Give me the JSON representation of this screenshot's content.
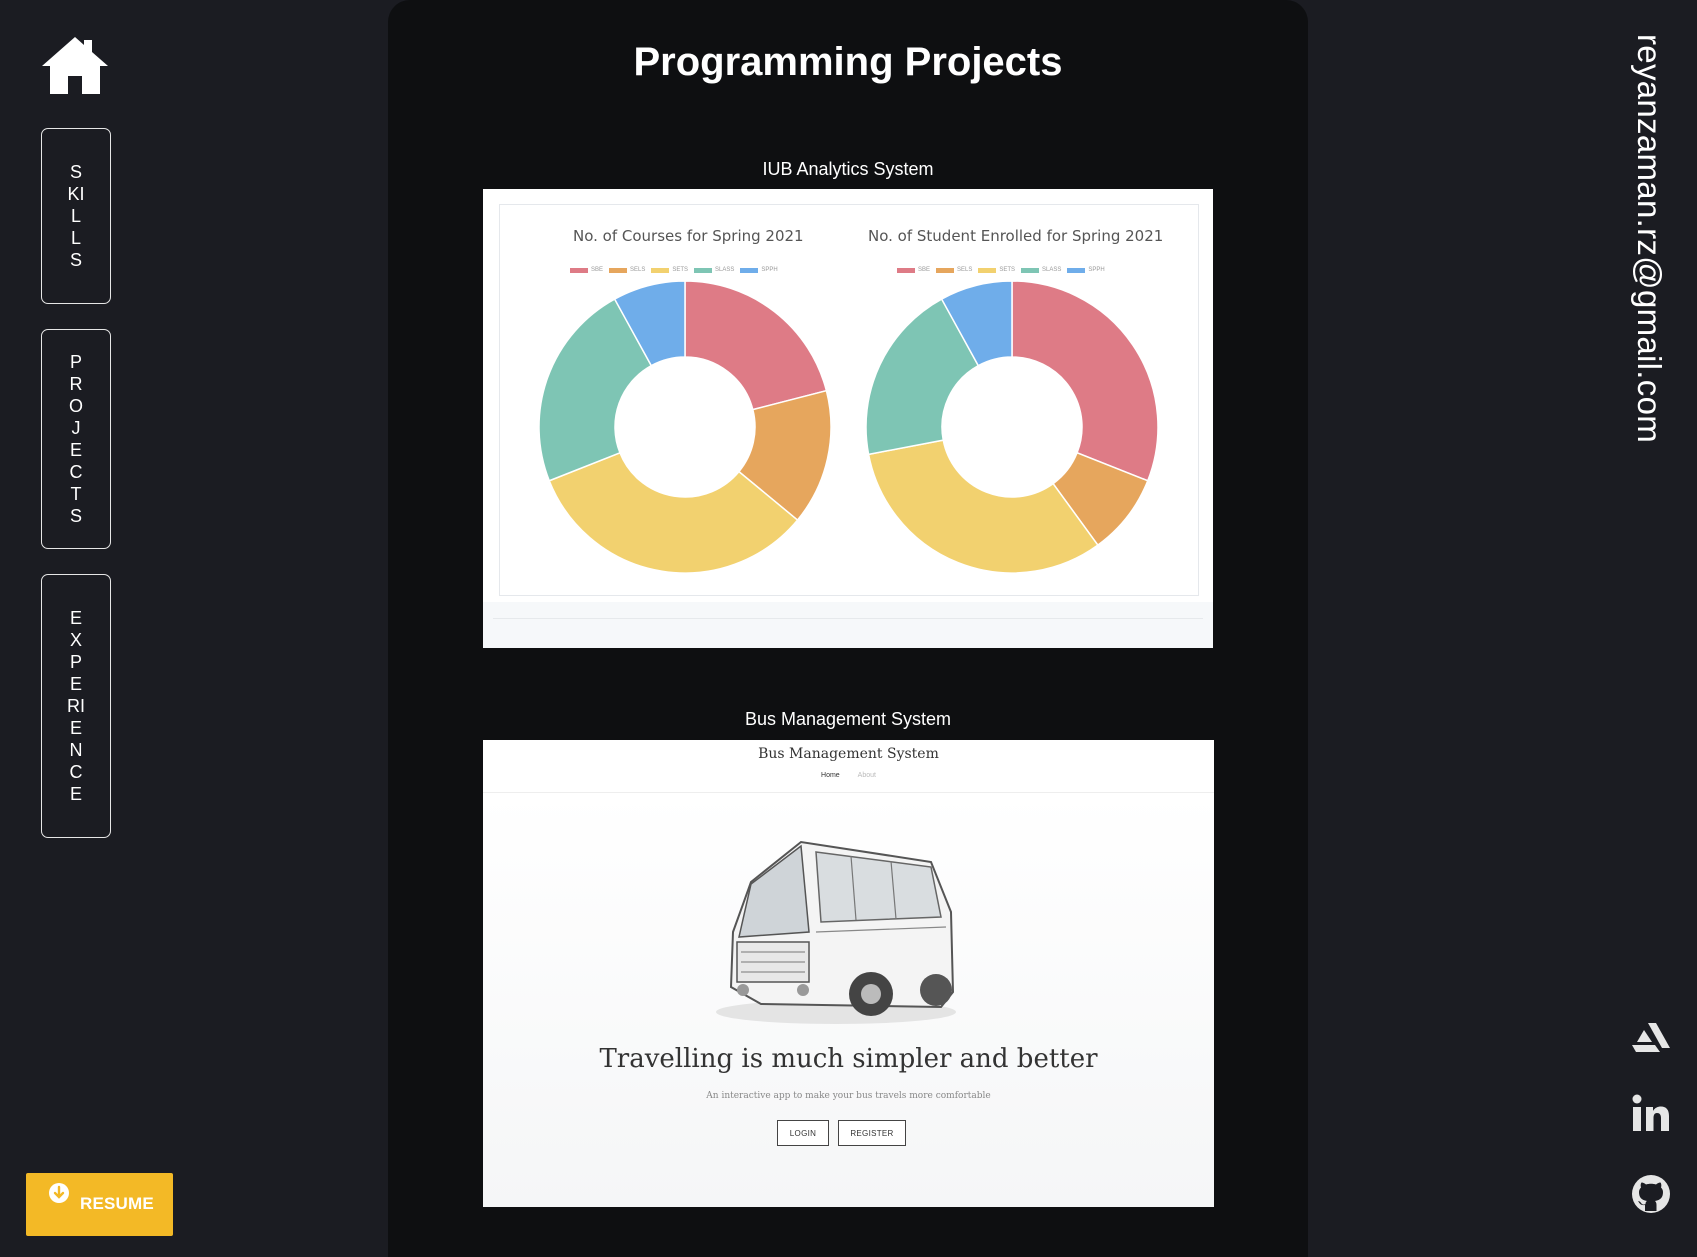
{
  "sidebar": {
    "home_icon": "home-icon",
    "nav": [
      {
        "label": "SKILLS"
      },
      {
        "label": "PROJECTS"
      },
      {
        "label": "EXPERIENCE"
      }
    ],
    "resume": {
      "label": "RESUME",
      "icon": "download-icon",
      "color": "#f3b926"
    }
  },
  "main": {
    "title": "Programming Projects",
    "projects": [
      {
        "title": "IUB Analytics System",
        "charts": [
          {
            "title": "No. of Courses for Spring 2021"
          },
          {
            "title": "No. of Student Enrolled for Spring 2021"
          }
        ]
      },
      {
        "title": "Bus Management System",
        "site": {
          "title": "Bus Management System",
          "nav": [
            "Home",
            "About"
          ],
          "hero": "Travelling is much simpler and better",
          "subtitle": "An interactive app to make your bus travels more comfortable",
          "buttons": [
            "LOGIN",
            "REGISTER"
          ]
        }
      }
    ]
  },
  "chart_data": [
    {
      "type": "pie",
      "title": "No. of Courses for Spring 2021",
      "categories": [
        "SBE",
        "SELS",
        "SETS",
        "SLASS",
        "SPPH"
      ],
      "values": [
        21,
        15,
        33,
        23,
        8
      ],
      "colors": [
        "#de7b86",
        "#e6a65d",
        "#f2d16f",
        "#7ec5b4",
        "#6fadea"
      ],
      "legend": "top"
    },
    {
      "type": "pie",
      "title": "No. of Student Enrolled for Spring 2021",
      "categories": [
        "SBE",
        "SELS",
        "SETS",
        "SLASS",
        "SPPH"
      ],
      "values": [
        31,
        9,
        32,
        20,
        8
      ],
      "colors": [
        "#de7b86",
        "#e6a65d",
        "#f2d16f",
        "#7ec5b4",
        "#6fadea"
      ],
      "legend": "top"
    }
  ],
  "right_bar": {
    "email": "reyanzaman.rz@gmail.com",
    "social": [
      "artstation-icon",
      "linkedin-icon",
      "github-icon"
    ]
  },
  "colors": {
    "background": "#1b1c22",
    "main_panel": "#0e0f11",
    "accent": "#f3b926"
  }
}
